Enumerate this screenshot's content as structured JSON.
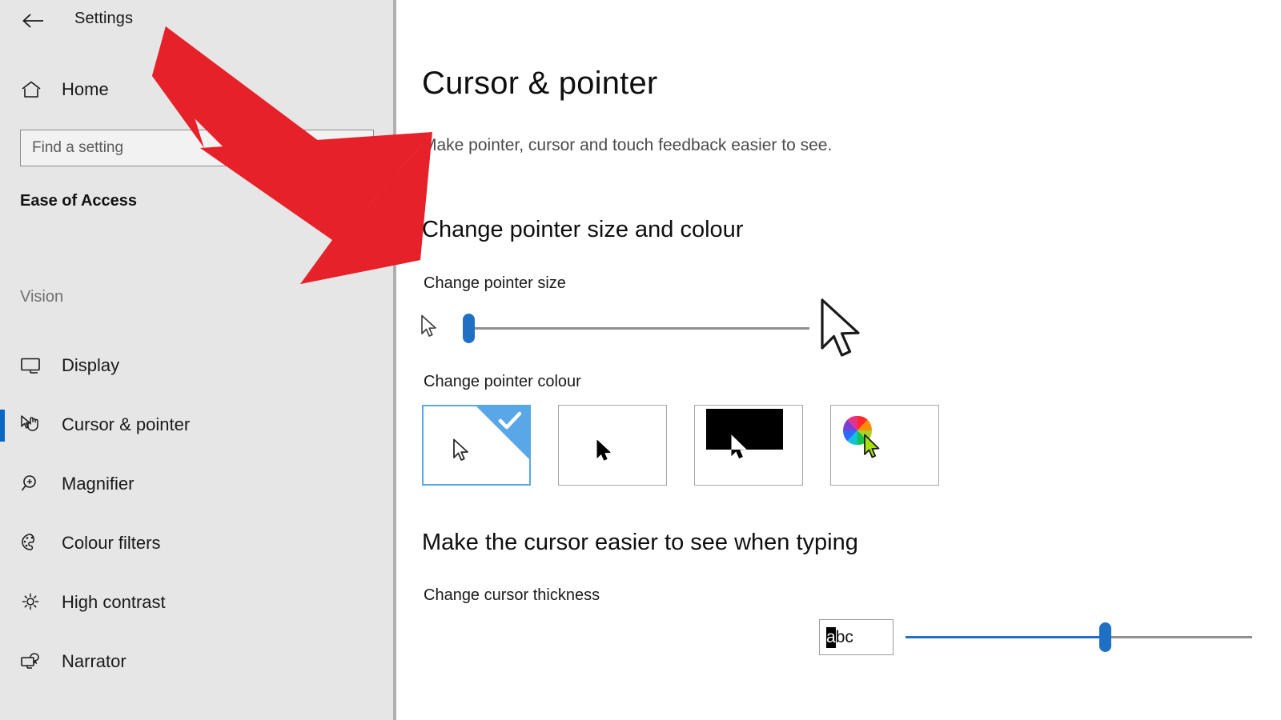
{
  "window": {
    "title": "Settings",
    "back_icon": "back-arrow-icon"
  },
  "sidebar": {
    "home": {
      "label": "Home",
      "icon": "home-icon"
    },
    "search": {
      "placeholder": "Find a setting",
      "value": "",
      "icon": "search-icon"
    },
    "category": "Ease of Access",
    "group_label": "Vision",
    "items": [
      {
        "label": "Display",
        "icon": "monitor-icon",
        "selected": false
      },
      {
        "label": "Cursor & pointer",
        "icon": "cursor-hand-icon",
        "selected": true
      },
      {
        "label": "Magnifier",
        "icon": "magnifier-plus-icon",
        "selected": false
      },
      {
        "label": "Colour filters",
        "icon": "palette-icon",
        "selected": false
      },
      {
        "label": "High contrast",
        "icon": "brightness-sun-icon",
        "selected": false
      },
      {
        "label": "Narrator",
        "icon": "narrator-speech-icon",
        "selected": false
      }
    ]
  },
  "main": {
    "title": "Cursor & pointer",
    "subtitle": "Make pointer, cursor and touch feedback easier to see.",
    "sections": [
      {
        "heading": "Change pointer size and colour",
        "size_label": "Change pointer size",
        "size_slider": {
          "value": 1,
          "min": 1,
          "max": 15
        },
        "colour_label": "Change pointer colour",
        "swatches": [
          {
            "name": "white-pointer",
            "selected": true
          },
          {
            "name": "black-pointer",
            "selected": false
          },
          {
            "name": "inverted-pointer",
            "selected": false
          },
          {
            "name": "custom-colour-pointer",
            "selected": false
          }
        ]
      },
      {
        "heading": "Make the cursor easier to see when typing",
        "thickness_label": "Change cursor thickness",
        "preview": {
          "highlighted": "a",
          "rest": "bc"
        },
        "thickness_slider": {
          "value": 57,
          "min": 1,
          "max": 20
        }
      }
    ]
  },
  "annotation": {
    "name": "red-pointer-arrow",
    "colour": "#e62129"
  },
  "colours": {
    "sidebar_bg": "#e6e6e6",
    "accent": "#0a68c4",
    "slider_blue": "#1f6fc4",
    "selection_blue": "#5aa7e8"
  }
}
